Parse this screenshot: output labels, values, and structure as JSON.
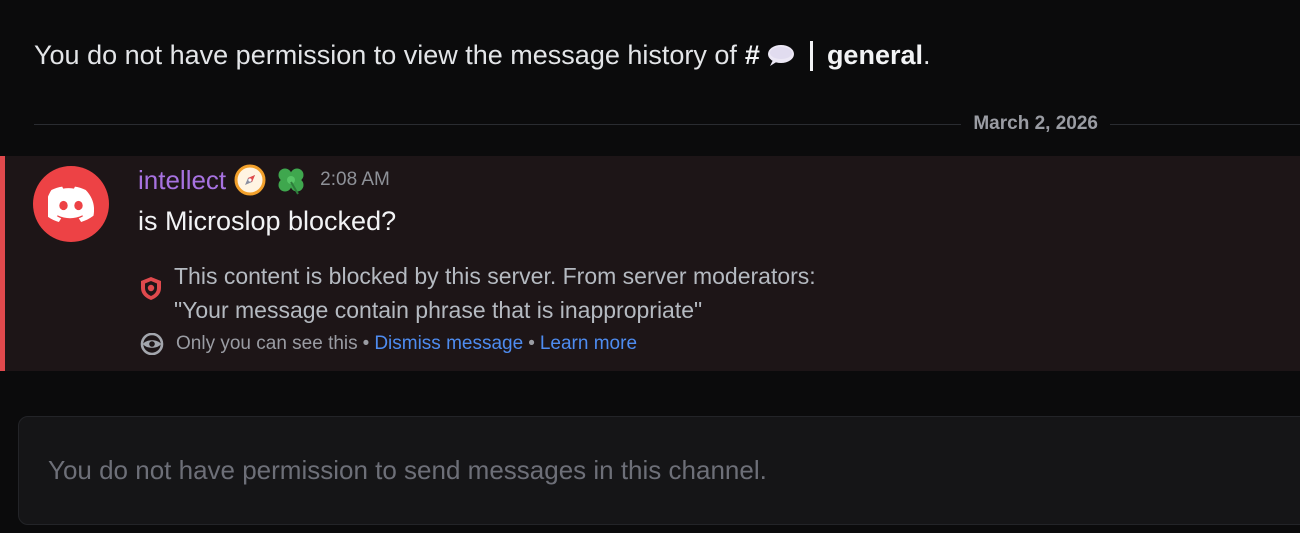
{
  "history_notice": {
    "prefix": "You do not have permission to view the message history of",
    "hash": "#",
    "channel_name": "general",
    "suffix": ".",
    "icon": "speech-bubble-icon"
  },
  "date_divider": {
    "label": "March 2, 2026"
  },
  "message": {
    "username": "intellect",
    "username_color": "#a772e0",
    "badges": [
      "compass-badge-icon",
      "clover-badge-icon"
    ],
    "timestamp": "2:08 AM",
    "content": "is Microslop blocked?",
    "avatar_icon": "discord-logo-icon",
    "avatar_color": "#ed4245",
    "blocked_notice": {
      "line1": "This content is blocked by this server. From server moderators:",
      "line2": "\"Your message contain phrase that is inappropriate\"",
      "icon": "shield-icon"
    },
    "ephemeral": {
      "label": "Only you can see this",
      "separator": "•",
      "dismiss_link": "Dismiss message",
      "learn_more_link": "Learn more",
      "icon": "eye-icon"
    }
  },
  "composer": {
    "placeholder": "You do not have permission to send messages in this channel."
  },
  "colors": {
    "accent_link": "#4e8cf0",
    "blocked_border": "#e0494d",
    "background": "#0b0b0c"
  }
}
